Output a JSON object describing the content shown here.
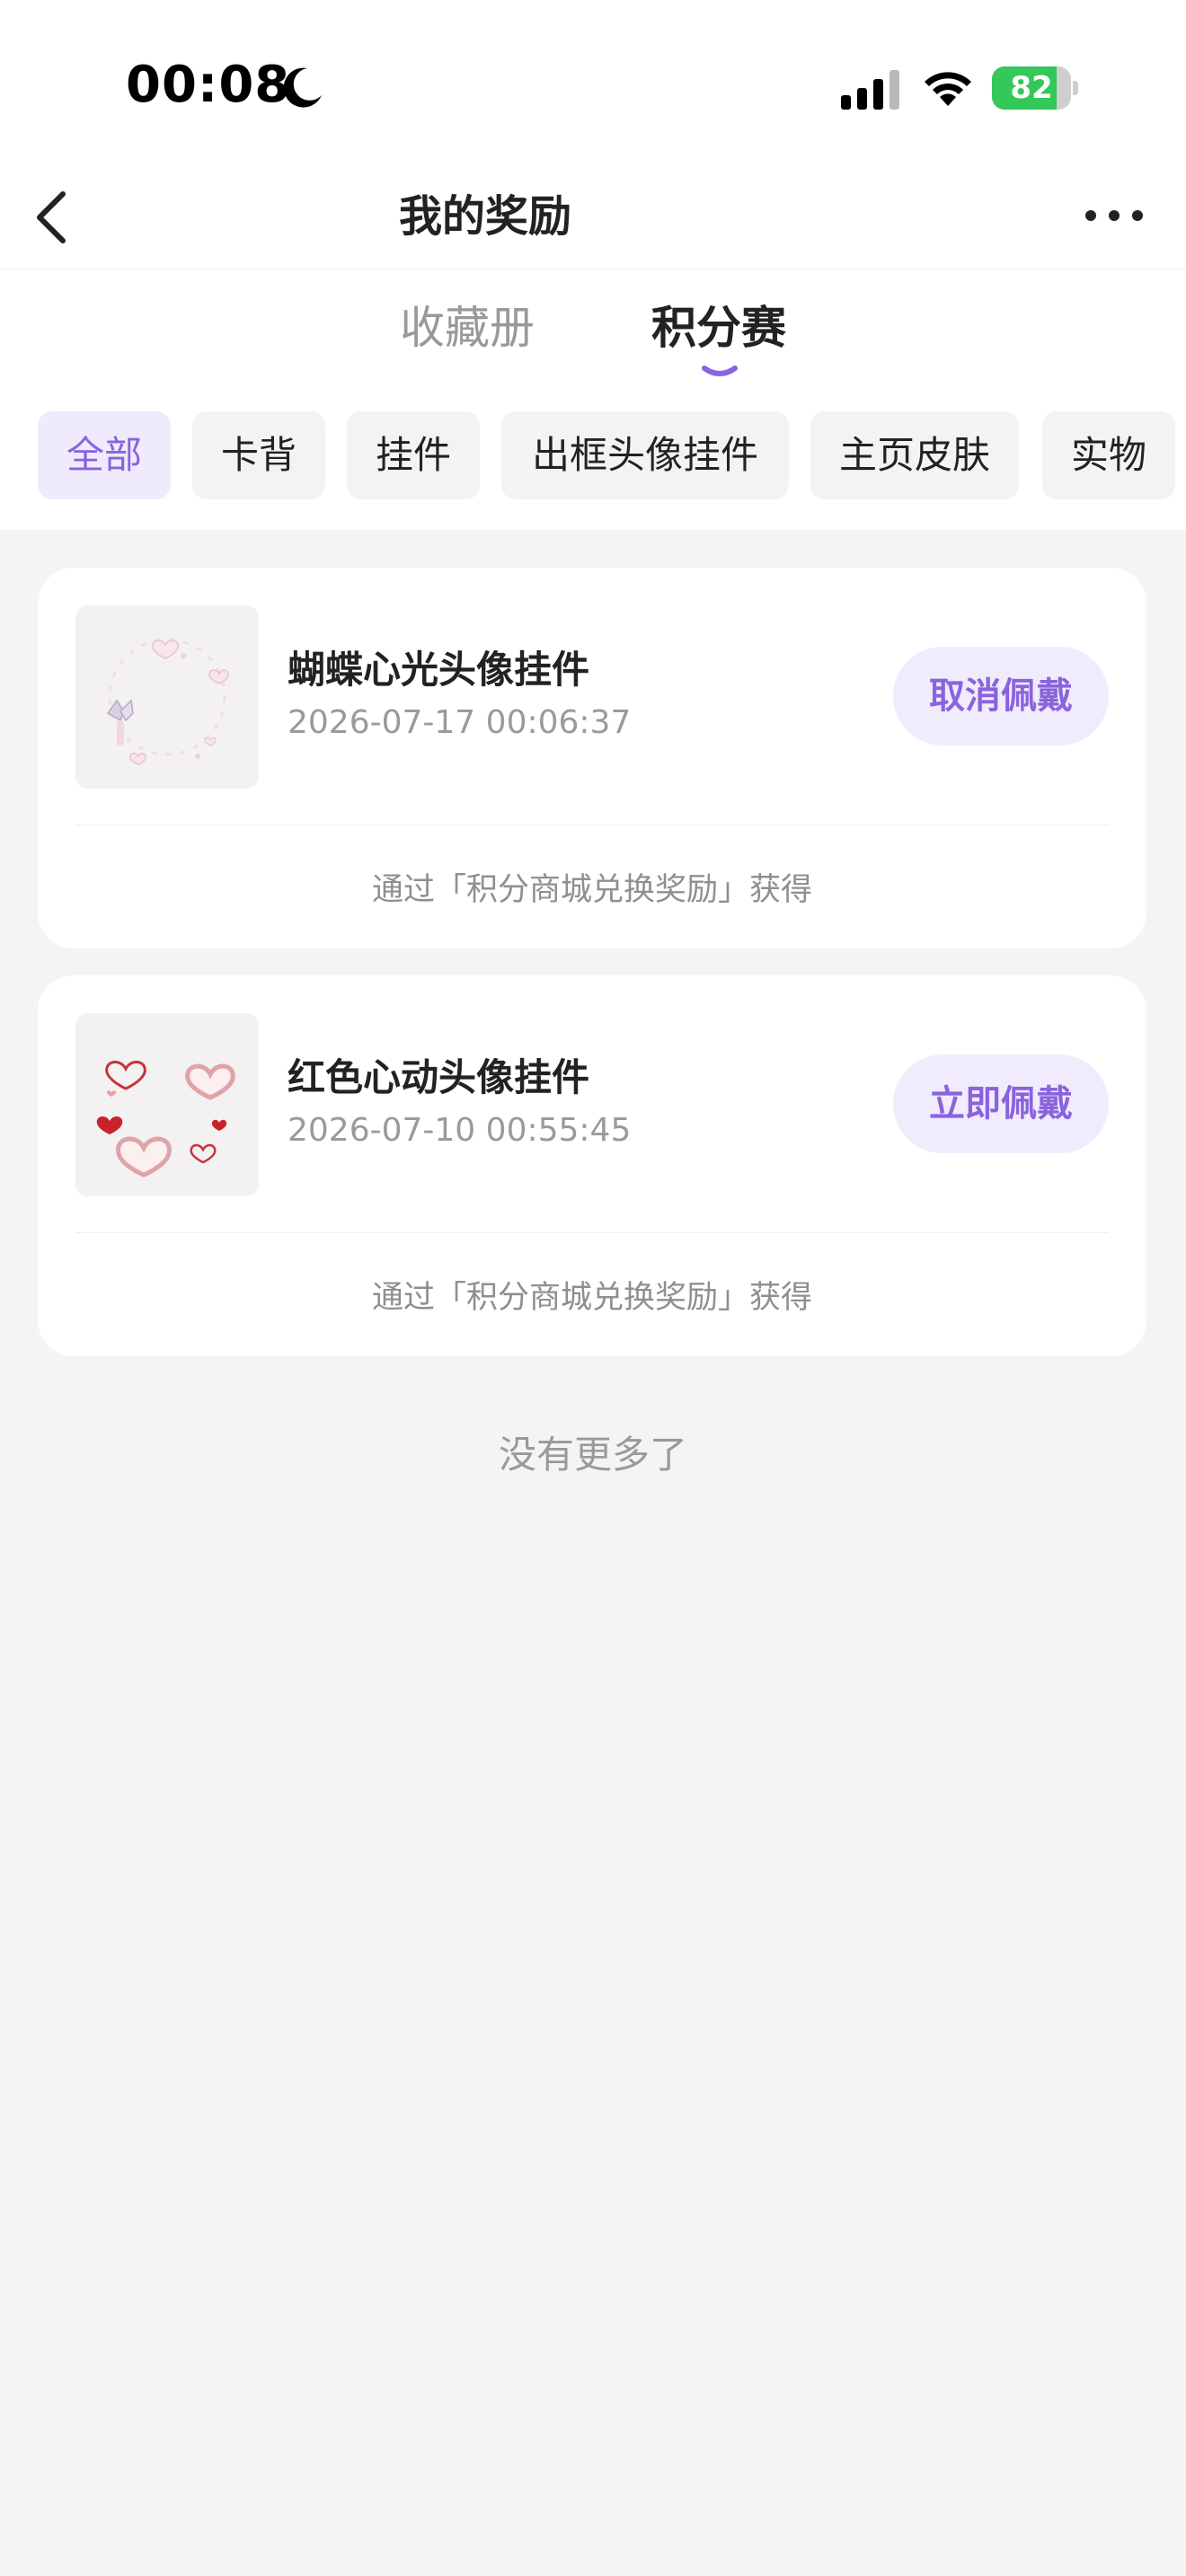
{
  "status_bar": {
    "time": "00:08",
    "battery_text": "82",
    "battery_level": 0.82,
    "battery_color": "#34c759",
    "icons": [
      "moon-icon",
      "signal-icon",
      "wifi-icon",
      "battery-icon"
    ]
  },
  "nav": {
    "title": "我的奖励",
    "back_icon": "chevron-left-icon",
    "more_icon": "more-horizontal-icon"
  },
  "tabs": [
    {
      "label": "收藏册",
      "active": false
    },
    {
      "label": "积分赛",
      "active": true
    }
  ],
  "filters": [
    {
      "label": "全部",
      "active": true
    },
    {
      "label": "卡背",
      "active": false
    },
    {
      "label": "挂件",
      "active": false
    },
    {
      "label": "出框头像挂件",
      "active": false
    },
    {
      "label": "主页皮肤",
      "active": false
    },
    {
      "label": "实物",
      "active": false
    }
  ],
  "rewards": [
    {
      "name": "蝴蝶心光头像挂件",
      "date": "2026-07-17 00:06:37",
      "action": "取消佩戴",
      "source": "通过「积分商城兑换奖励」获得"
    },
    {
      "name": "红色心动头像挂件",
      "date": "2026-07-10 00:55:45",
      "action": "立即佩戴",
      "source": "通过「积分商城兑换奖励」获得"
    }
  ],
  "footer": {
    "no_more": "没有更多了"
  },
  "colors": {
    "accent": "#8a63de",
    "accent_bg": "#efeafc",
    "page_bg": "#f4f4f4"
  }
}
